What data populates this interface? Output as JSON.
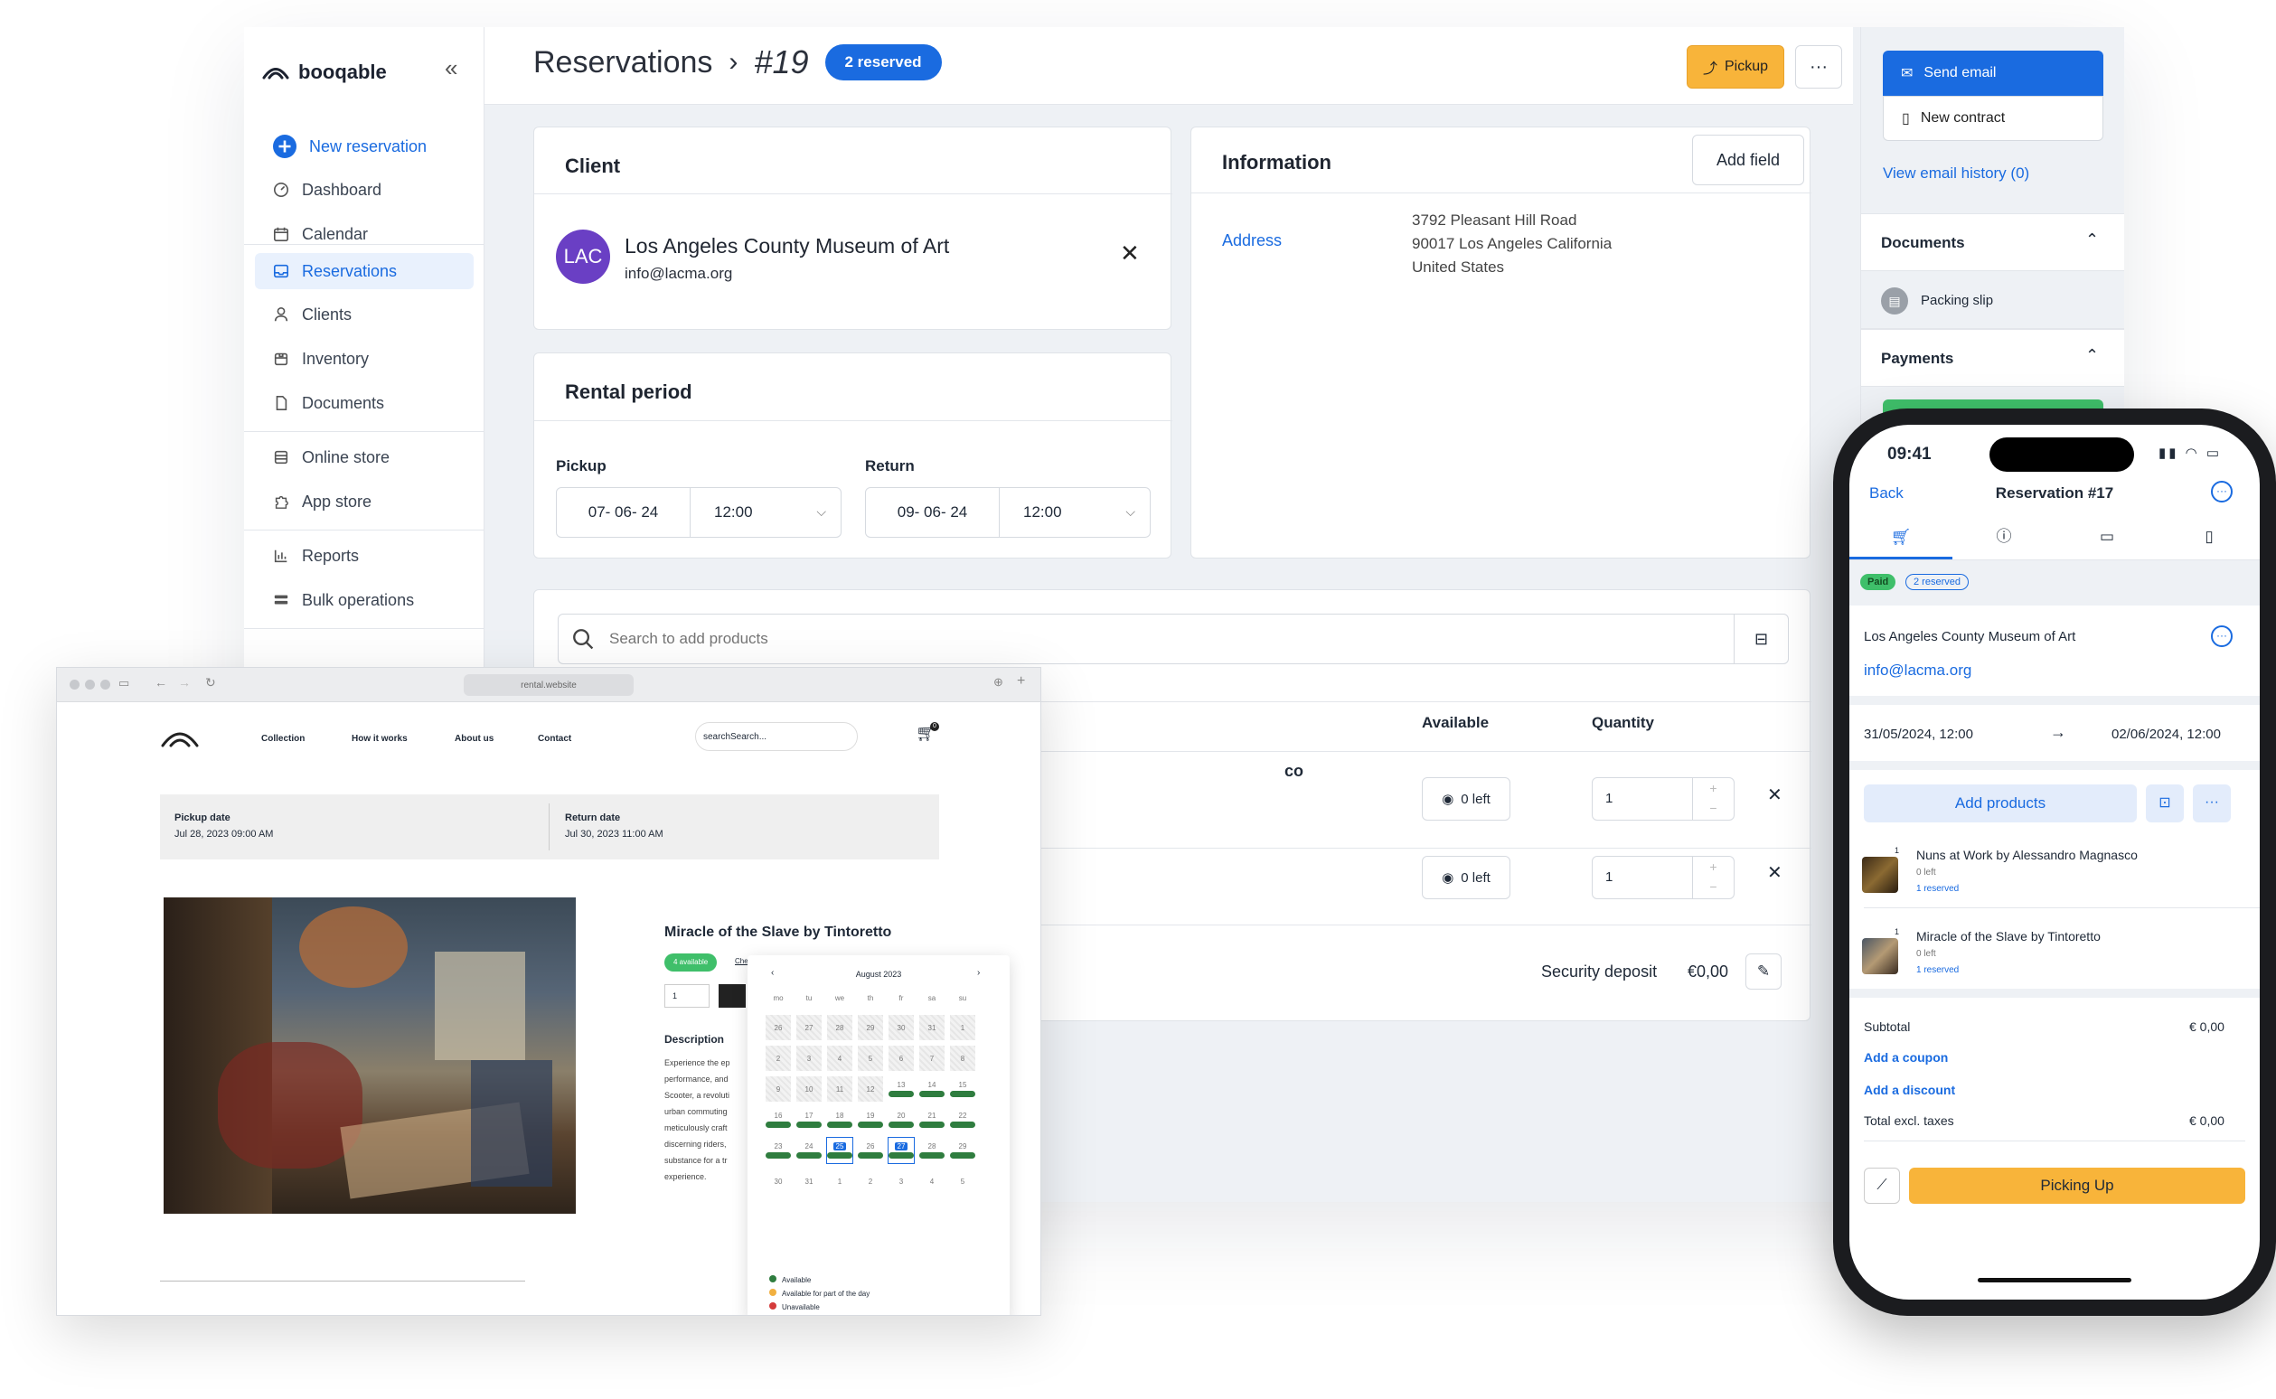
{
  "app": {
    "brand": "booqable",
    "nav": {
      "new_reservation": "New reservation",
      "dashboard": "Dashboard",
      "calendar": "Calendar",
      "reservations": "Reservations",
      "clients": "Clients",
      "inventory": "Inventory",
      "documents": "Documents",
      "online_store": "Online store",
      "app_store": "App store",
      "reports": "Reports",
      "bulk_operations": "Bulk operations"
    },
    "header": {
      "section": "Reservations",
      "number": "#19",
      "status_badge": "2 reserved",
      "pickup_button": "Pickup",
      "more_button": "···"
    },
    "client": {
      "title": "Client",
      "initials": "LAC",
      "name": "Los Angeles County Museum of Art",
      "email": "info@lacma.org",
      "avatar_color": "#6a3fc4"
    },
    "information": {
      "title": "Information",
      "add_field": "Add field",
      "address_label": "Address",
      "address_line1": "3792 Pleasant Hill Road",
      "address_line2": "90017 Los Angeles California",
      "address_line3": "United States"
    },
    "rental_period": {
      "title": "Rental period",
      "pickup_label": "Pickup",
      "pickup_date": "07- 06- 24",
      "pickup_time": "12:00",
      "return_label": "Return",
      "return_date": "09- 06- 24",
      "return_time": "12:00"
    },
    "products": {
      "search_placeholder": "Search to add products",
      "col_available": "Available",
      "col_quantity": "Quantity",
      "partial_name": "co",
      "rows": [
        {
          "available": "0 left",
          "quantity": "1"
        },
        {
          "available": "0 left",
          "quantity": "1"
        }
      ],
      "deposit_label": "Security deposit",
      "deposit_value": "€0,00"
    },
    "right_panel": {
      "send_email": "Send email",
      "new_contract": "New contract",
      "email_history": "View email history (0)",
      "documents_title": "Documents",
      "packing_slip": "Packing slip",
      "payments_title": "Payments"
    }
  },
  "browser": {
    "url": "rental.website",
    "nav": {
      "collection": "Collection",
      "how_it_works": "How it works",
      "about_us": "About us",
      "contact": "Contact",
      "search": "searchSearch...",
      "cart_count": "0"
    },
    "pickup_label": "Pickup date",
    "pickup_value": "Jul 28, 2023 09:00 AM",
    "return_label": "Return date",
    "return_value": "Jul 30, 2023 11:00 AM",
    "product_title": "Miracle of the Slave by Tintoretto",
    "available_badge": "4 available",
    "check_link": "Che",
    "qty": "1",
    "description_title": "Description",
    "description_lines": [
      "Experience the ep",
      "performance, and",
      "Scooter, a revoluti",
      "urban commuting",
      "meticulously craft",
      "discerning riders,",
      "substance for a tr",
      "experience."
    ],
    "calendar": {
      "month": "August 2023",
      "weekdays": [
        "mo",
        "tu",
        "we",
        "th",
        "fr",
        "sa",
        "su"
      ],
      "days": [
        "26",
        "27",
        "28",
        "29",
        "30",
        "31",
        "1",
        "2",
        "3",
        "4",
        "5",
        "6",
        "7",
        "8",
        "9",
        "10",
        "11",
        "12",
        "13",
        "14",
        "15",
        "16",
        "17",
        "18",
        "19",
        "20",
        "21",
        "22",
        "23",
        "24",
        "25",
        "26",
        "27",
        "28",
        "29",
        "30",
        "31",
        "1",
        "2",
        "3",
        "4",
        "5"
      ],
      "legend_available": "Available",
      "legend_partial": "Available for part of the day",
      "legend_unavailable": "Unavailable"
    }
  },
  "phone": {
    "time": "09:41",
    "back": "Back",
    "title": "Reservation #17",
    "paid_badge": "Paid",
    "reserved_badge": "2 reserved",
    "client_name": "Los Angeles County Museum of Art",
    "client_email": "info@lacma.org",
    "start": "31/05/2024, 12:00",
    "end": "02/06/2024, 12:00",
    "add_products": "Add products",
    "lines": [
      {
        "qty": "1",
        "name": "Nuns at Work by Alessandro Magnasco",
        "left": "0 left",
        "reserved": "1 reserved"
      },
      {
        "qty": "1",
        "name": "Miracle of the Slave by Tintoretto",
        "left": "0 left",
        "reserved": "1 reserved"
      }
    ],
    "subtotal_label": "Subtotal",
    "subtotal_value": "€ 0,00",
    "add_coupon": "Add a coupon",
    "add_discount": "Add a discount",
    "total_excl_label": "Total excl. taxes",
    "total_excl_value": "€ 0,00",
    "picking_up": "Picking Up"
  }
}
